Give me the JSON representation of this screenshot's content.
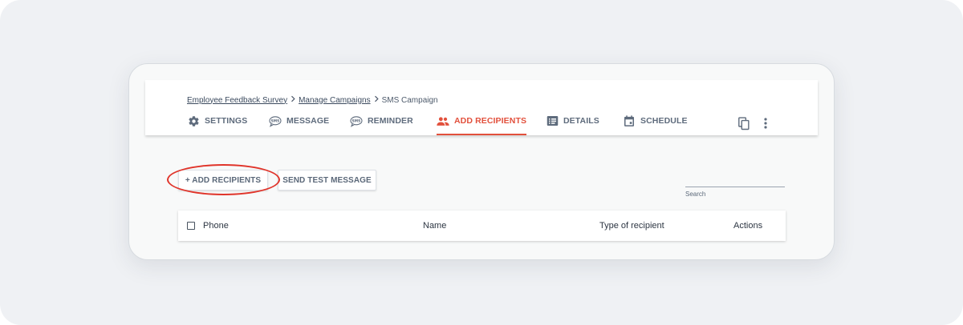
{
  "breadcrumb": {
    "items": [
      "Employee Feedback Survey",
      "Manage Campaigns"
    ],
    "current": "SMS Campaign"
  },
  "tabs": [
    {
      "label": "SETTINGS",
      "icon": "gear-icon"
    },
    {
      "label": "MESSAGE",
      "icon": "sms-bubble-icon"
    },
    {
      "label": "REMINDER",
      "icon": "sms-bubble-icon"
    },
    {
      "label": "ADD RECIPIENTS",
      "icon": "people-icon",
      "active": true
    },
    {
      "label": "DETAILS",
      "icon": "list-box-icon"
    },
    {
      "label": "SCHEDULE",
      "icon": "calendar-icon"
    }
  ],
  "header_actions": [
    "copy-icon",
    "more-vertical-icon"
  ],
  "actions": {
    "add_recipients": "+ ADD RECIPIENTS",
    "send_test": "SEND TEST MESSAGE"
  },
  "search": {
    "label": "Search",
    "value": ""
  },
  "table": {
    "columns": [
      "Phone",
      "Name",
      "Type of recipient",
      "Actions"
    ]
  },
  "colors": {
    "accent": "#e2503c",
    "highlight": "#e0342a",
    "text_muted": "#5e6b7c"
  }
}
